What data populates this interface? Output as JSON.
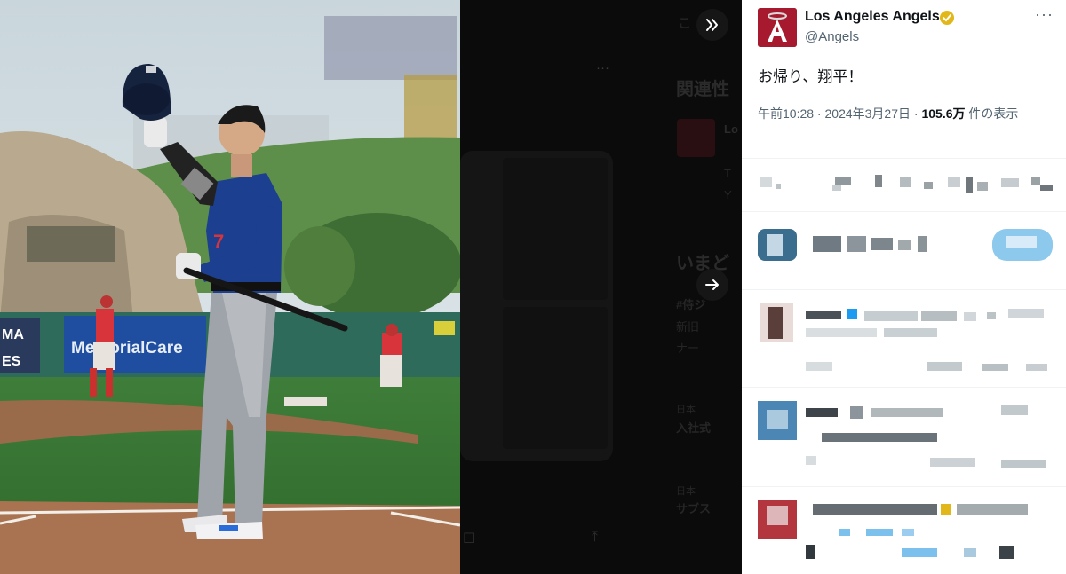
{
  "nav": {
    "collapse_icon": "double-chevron-right-icon",
    "next_icon": "arrow-right-icon"
  },
  "background": {
    "more_icon": "···",
    "section_related": "関連性",
    "section_now": "いまど",
    "like_icon": "bookmark-icon",
    "share_icon": "share-icon"
  },
  "tweet": {
    "display_name": "Los Angeles Angels",
    "handle": "@Angels",
    "text": "お帰り、翔平！",
    "time": "午前10:28",
    "date": "2024年3月27日",
    "views": "105.6万",
    "views_label": "件の表示",
    "more_icon": "···"
  },
  "colors": {
    "angels_red": "#a6192e",
    "verified_gold": "#e2b719",
    "dodger_blue": "#1c3f8f"
  }
}
